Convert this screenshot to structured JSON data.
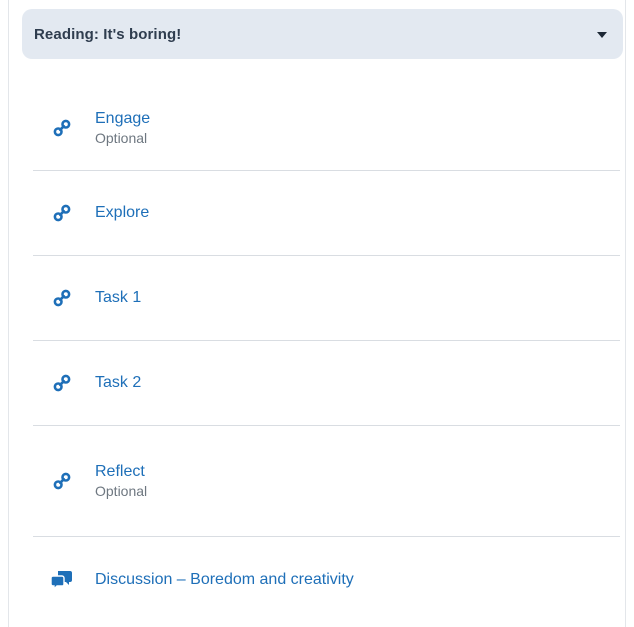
{
  "module": {
    "title": "Reading: It's boring!"
  },
  "items": [
    {
      "title": "Engage",
      "subtitle": "Optional",
      "icon": "link-icon"
    },
    {
      "title": "Explore",
      "subtitle": "",
      "icon": "link-icon"
    },
    {
      "title": "Task 1",
      "subtitle": "",
      "icon": "link-icon"
    },
    {
      "title": "Task 2",
      "subtitle": "",
      "icon": "link-icon"
    },
    {
      "title": "Reflect",
      "subtitle": "Optional",
      "icon": "link-icon"
    },
    {
      "title": "Discussion – Boredom and creativity",
      "subtitle": "",
      "icon": "discussion-icon"
    }
  ],
  "colors": {
    "header_bg": "#e3e9f1",
    "link_blue": "#1e6fb8",
    "muted_text": "#6e7780"
  }
}
